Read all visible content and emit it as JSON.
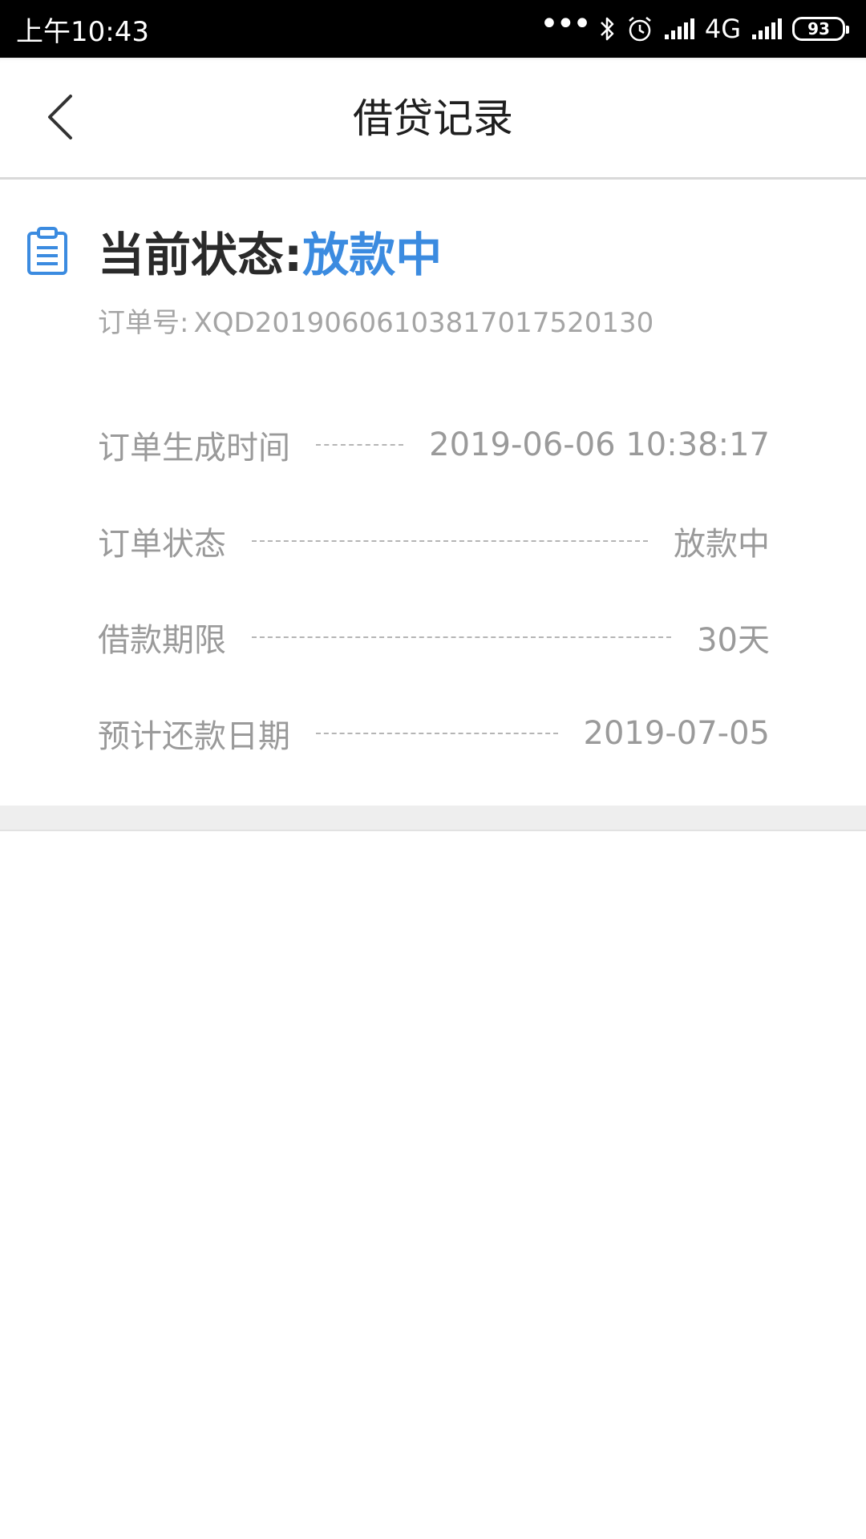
{
  "status_bar": {
    "time": "上午10:43",
    "dots": "•••",
    "network_label": "4G",
    "battery_level": "93"
  },
  "header": {
    "title": "借贷记录",
    "back_icon": "chevron-left-icon"
  },
  "status_card": {
    "icon": "clipboard-icon",
    "status_label": "当前状态:",
    "status_value": "放款中",
    "order_number_label": "订单号:",
    "order_number_value": "XQD20190606103817017520130",
    "rows": [
      {
        "label": "订单生成时间",
        "value": "2019-06-06 10:38:17"
      },
      {
        "label": "订单状态",
        "value": "放款中"
      },
      {
        "label": "借款期限",
        "value": "30天"
      },
      {
        "label": "预计还款日期",
        "value": "2019-07-05"
      }
    ]
  },
  "colors": {
    "accent_blue": "#3b8be0",
    "muted_text": "#9a9a9a",
    "separator_gray": "#eeeeee"
  }
}
